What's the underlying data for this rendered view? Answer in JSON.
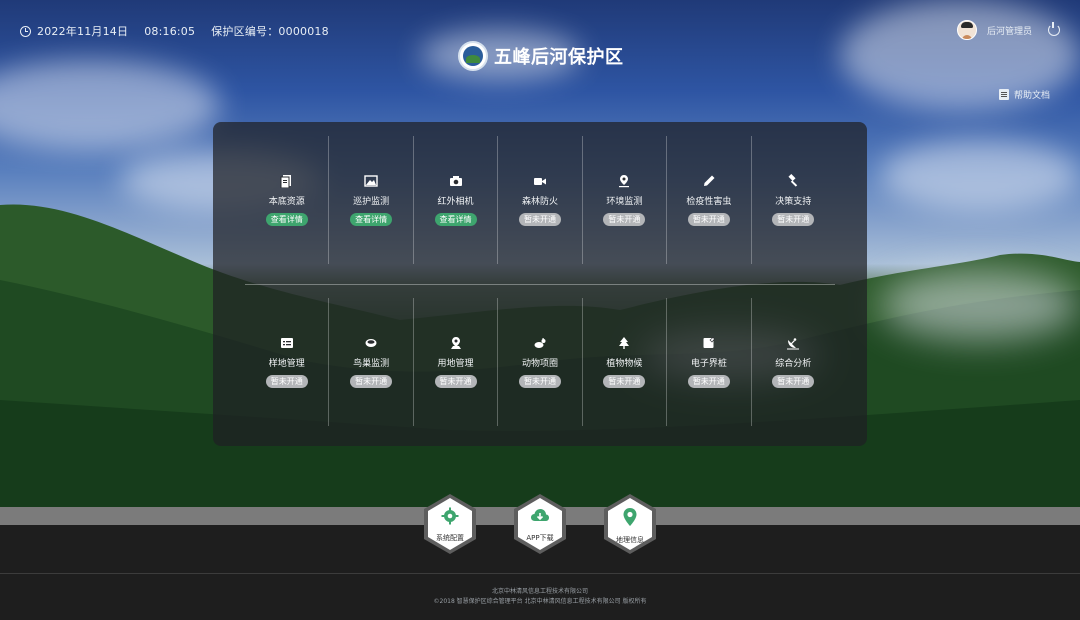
{
  "topbar": {
    "date": "2022年11月14日",
    "time": "08:16:05",
    "reserve_code_label": "保护区编号：",
    "reserve_code": "0000018"
  },
  "brand": {
    "title": "五峰后河保护区"
  },
  "user": {
    "name": "后河管理员"
  },
  "help": {
    "label": "帮助文档"
  },
  "badges": {
    "view": "查看详情",
    "closed": "暂未开通"
  },
  "modules_row1": [
    {
      "label": "本底资源",
      "icon": "document-stack-icon",
      "status": "view"
    },
    {
      "label": "巡护监测",
      "icon": "landscape-image-icon",
      "status": "view"
    },
    {
      "label": "红外相机",
      "icon": "camera-icon",
      "status": "view"
    },
    {
      "label": "森林防火",
      "icon": "video-camera-icon",
      "status": "closed"
    },
    {
      "label": "环境监测",
      "icon": "map-pin-icon",
      "status": "closed"
    },
    {
      "label": "检疫性害虫",
      "icon": "pen-icon",
      "status": "closed"
    },
    {
      "label": "决策支持",
      "icon": "gavel-icon",
      "status": "closed"
    }
  ],
  "modules_row2": [
    {
      "label": "样地管理",
      "icon": "list-card-icon",
      "status": "closed"
    },
    {
      "label": "鸟巢监测",
      "icon": "nest-icon",
      "status": "closed"
    },
    {
      "label": "用地管理",
      "icon": "location-icon",
      "status": "closed"
    },
    {
      "label": "动物项圈",
      "icon": "animal-icon",
      "status": "closed"
    },
    {
      "label": "植物物候",
      "icon": "tree-icon",
      "status": "closed"
    },
    {
      "label": "电子界桩",
      "icon": "boundary-marker-icon",
      "status": "closed"
    },
    {
      "label": "综合分析",
      "icon": "satellite-dish-icon",
      "status": "closed"
    }
  ],
  "actions": [
    {
      "label": "系统配置",
      "icon": "gear-icon"
    },
    {
      "label": "APP下载",
      "icon": "cloud-download-icon"
    },
    {
      "label": "地理信息",
      "icon": "map-marker-icon"
    }
  ],
  "colors": {
    "active_badge": "#3ea56e",
    "closed_badge": "#b3b5b8",
    "accent_green": "#3ea56e"
  },
  "footer": {
    "line1": "北京中林清风信息工程技术有限公司",
    "line2": "©2018 智慧保护区综合管理平台 北京中林清风信息工程技术有限公司 版权所有"
  }
}
